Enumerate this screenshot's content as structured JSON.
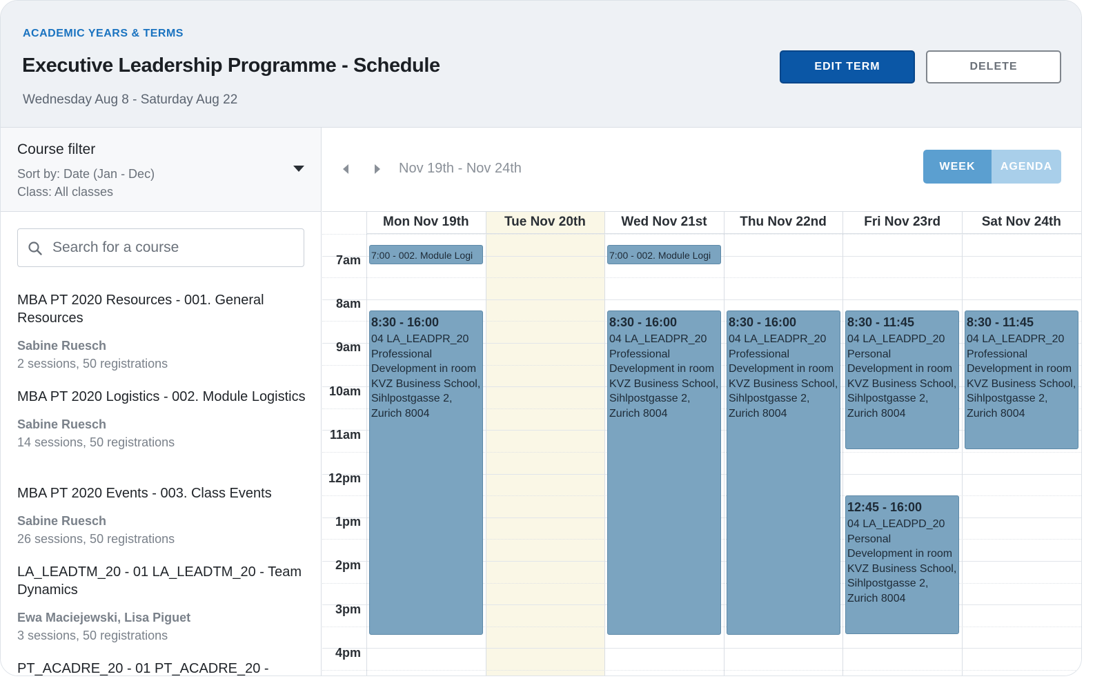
{
  "header": {
    "breadcrumb": "ACADEMIC YEARS & TERMS",
    "title": "Executive Leadership Programme - Schedule",
    "date_range": "Wednesday Aug 8 - Saturday Aug 22",
    "edit_label": "EDIT TERM",
    "delete_label": "DELETE"
  },
  "filter": {
    "title": "Course filter",
    "sort": "Sort by: Date (Jan - Dec)",
    "class": "Class: All classes"
  },
  "search": {
    "placeholder": "Search for a course"
  },
  "courses": [
    {
      "name": "MBA PT 2020 Resources  - 001. General Resources",
      "instructor": "Sabine Ruesch",
      "stats": "2 sessions, 50 registrations"
    },
    {
      "name": "MBA PT 2020 Logistics - 002. Module Logistics",
      "instructor": "Sabine Ruesch",
      "stats": "14 sessions, 50 registrations"
    },
    {
      "name": "MBA PT 2020 Events - 003. Class Events",
      "instructor": "Sabine Ruesch",
      "stats": "26 sessions, 50 registrations"
    },
    {
      "name": "LA_LEADTM_20 - 01 LA_LEADTM_20 - Team Dynamics",
      "instructor": "Ewa Maciejewski, Lisa Piguet",
      "stats": "3 sessions, 50 registrations"
    },
    {
      "name": "PT_ACADRE_20 - 01 PT_ACADRE_20 -",
      "instructor": "",
      "stats": ""
    }
  ],
  "calendar": {
    "range": "Nov 19th - Nov 24th",
    "week_label": "WEEK",
    "agenda_label": "AGENDA",
    "days": [
      "Mon Nov 19th",
      "Tue Nov 20th",
      "Wed Nov 21st",
      "Thu Nov 22nd",
      "Fri Nov 23rd",
      "Sat Nov 24th"
    ],
    "today_index": 1,
    "hours": [
      "7am",
      "8am",
      "9am",
      "10am",
      "11am",
      "12pm",
      "1pm",
      "2pm",
      "3pm",
      "4pm"
    ],
    "events": [
      {
        "day": 0,
        "start": 7.0,
        "end": 7.5,
        "title": "7:00 - 002. Module Logi",
        "small": true
      },
      {
        "day": 2,
        "start": 7.0,
        "end": 7.5,
        "title": "7:00 - 002. Module Logi",
        "small": true
      },
      {
        "day": 0,
        "start": 8.5,
        "end": 16.0,
        "time": "8:30 - 16:00",
        "desc": "04 LA_LEADPR_20 Professional Development in room KVZ Business School, Sihlpostgasse 2, Zurich 8004"
      },
      {
        "day": 2,
        "start": 8.5,
        "end": 16.0,
        "time": "8:30 - 16:00",
        "desc": "04 LA_LEADPR_20 Professional Development in room KVZ Business School, Sihlpostgasse 2, Zurich 8004"
      },
      {
        "day": 3,
        "start": 8.5,
        "end": 16.0,
        "time": "8:30 - 16:00",
        "desc": "04 LA_LEADPR_20 Professional Development in room KVZ Business School, Sihlpostgasse 2, Zurich 8004"
      },
      {
        "day": 4,
        "start": 8.5,
        "end": 11.75,
        "time": "8:30 - 11:45",
        "desc": "04 LA_LEADPD_20 Personal Development in room KVZ Business School, Sihlpostgasse 2, Zurich 8004"
      },
      {
        "day": 5,
        "start": 8.5,
        "end": 11.75,
        "time": "8:30 - 11:45",
        "desc": "04 LA_LEADPR_20 Professional Development in room KVZ Business School, Sihlpostgasse 2, Zurich 8004"
      },
      {
        "day": 4,
        "start": 12.75,
        "end": 16.0,
        "time": "12:45 - 16:00",
        "desc": "04 LA_LEADPD_20 Personal Development in room KVZ Business School, Sihlpostgasse 2, Zurich 8004"
      }
    ]
  },
  "colors": {
    "primary": "#0b57a6",
    "event": "#7ba4c0",
    "today": "#faf7e6",
    "week_active": "#5b9fd0",
    "agenda_inactive": "#a9cfea"
  }
}
